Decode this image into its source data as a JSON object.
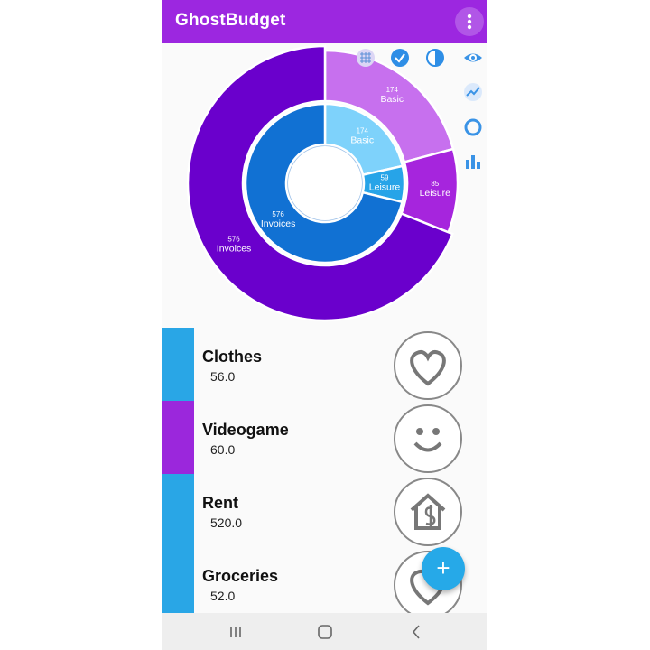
{
  "app": {
    "title": "GhostBudget"
  },
  "colors": {
    "appbar": "#9c27e0",
    "outer_purple": "#6a00cc",
    "outer_light_purple": "#c770ee",
    "outer_purple_mid": "#a625dd",
    "inner_blue_dark": "#1171d3",
    "inner_blue_light": "#7ed2fb",
    "inner_blue_mid": "#27a4e8",
    "list_blue": "#29a6e6",
    "list_purple": "#9b27dc",
    "fab": "#26a9e8"
  },
  "toolbar_icons": [
    "grid-icon",
    "check-circle-icon",
    "contrast-icon",
    "eye-icon",
    "trend-icon",
    "ring-icon",
    "bar-chart-icon"
  ],
  "chart_data": {
    "type": "pie",
    "rings": [
      {
        "name": "outer",
        "slices": [
          {
            "label": "Basic",
            "value": 174
          },
          {
            "label": "Leisure",
            "value": 85
          },
          {
            "label": "Invoices",
            "value": 576
          }
        ]
      },
      {
        "name": "inner",
        "slices": [
          {
            "label": "Basic",
            "value": 174
          },
          {
            "label": "Leisure",
            "value": 59
          },
          {
            "label": "Invoices",
            "value": 576
          }
        ]
      }
    ]
  },
  "items": [
    {
      "name": "Clothes",
      "amount": "56.0",
      "color": "#29a6e6",
      "icon": "heart-icon"
    },
    {
      "name": "Videogame",
      "amount": "60.0",
      "color": "#9b27dc",
      "icon": "smiley-icon"
    },
    {
      "name": "Rent",
      "amount": "520.0",
      "color": "#29a6e6",
      "icon": "house-dollar-icon"
    },
    {
      "name": "Groceries",
      "amount": "52.0",
      "color": "#29a6e6",
      "icon": "heart-icon"
    }
  ],
  "fab": {
    "label": "+"
  }
}
